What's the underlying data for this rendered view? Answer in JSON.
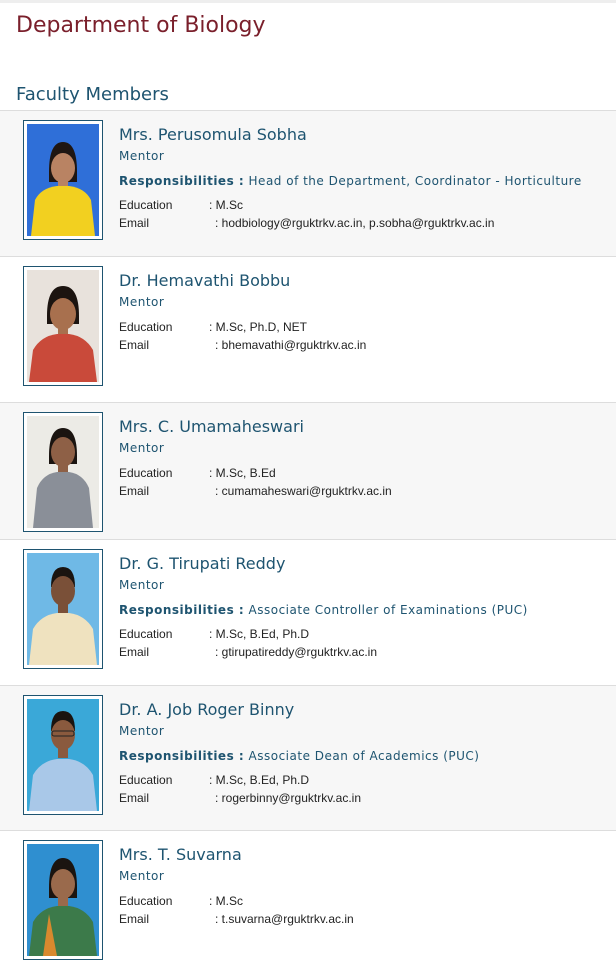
{
  "page": {
    "department_title": "Department of Biology",
    "section_title": "Faculty Members"
  },
  "faculty": [
    {
      "name": "Mrs. Perusomula Sobha",
      "role": "Mentor",
      "responsibilities_label": "Responsibilities :",
      "responsibilities": "Head of the Department, Coordinator - Horticulture",
      "education_label": "Education",
      "education": ": M.Sc",
      "email_label": "Email",
      "email": ": hodbiology@rguktrkv.ac.in, p.sobha@rguktrkv.ac.in",
      "photo_bg": "#2f6fd8",
      "photo_clothes": "#f2d020"
    },
    {
      "name": "Dr. Hemavathi Bobbu",
      "role": "Mentor",
      "education_label": "Education",
      "education": ": M.Sc, Ph.D, NET",
      "email_label": "Email",
      "email": ": bhemavathi@rguktrkv.ac.in",
      "photo_bg": "#e8e2dc",
      "photo_clothes": "#c94a3a"
    },
    {
      "name": "Mrs. C. Umamaheswari",
      "role": "Mentor",
      "education_label": "Education",
      "education": ": M.Sc, B.Ed",
      "email_label": "Email",
      "email": ": cumamaheswari@rguktrkv.ac.in",
      "photo_bg": "#ecebe6",
      "photo_clothes": "#8a8f98"
    },
    {
      "name": "Dr. G. Tirupati Reddy",
      "role": "Mentor",
      "responsibilities_label": "Responsibilities :",
      "responsibilities": "Associate Controller of Examinations (PUC)",
      "education_label": "Education",
      "education": ": M.Sc, B.Ed, Ph.D",
      "email_label": "Email",
      "email": ": gtirupatireddy@rguktrkv.ac.in",
      "photo_bg": "#6fb9e6",
      "photo_clothes": "#efe2bf"
    },
    {
      "name": "Dr. A. Job Roger Binny",
      "role": "Mentor",
      "responsibilities_label": "Responsibilities :",
      "responsibilities": "Associate Dean of Academics (PUC)",
      "education_label": "Education",
      "education": ": M.Sc, B.Ed, Ph.D",
      "email_label": "Email",
      "email": ": rogerbinny@rguktrkv.ac.in",
      "photo_bg": "#3aa8d8",
      "photo_clothes": "#a9c8e8"
    },
    {
      "name": "Mrs. T. Suvarna",
      "role": "Mentor",
      "education_label": "Education",
      "education": ": M.Sc",
      "email_label": "Email",
      "email": ": t.suvarna@rguktrkv.ac.in",
      "photo_bg": "#2f8fd0",
      "photo_clothes": "#3c7a4a"
    }
  ]
}
